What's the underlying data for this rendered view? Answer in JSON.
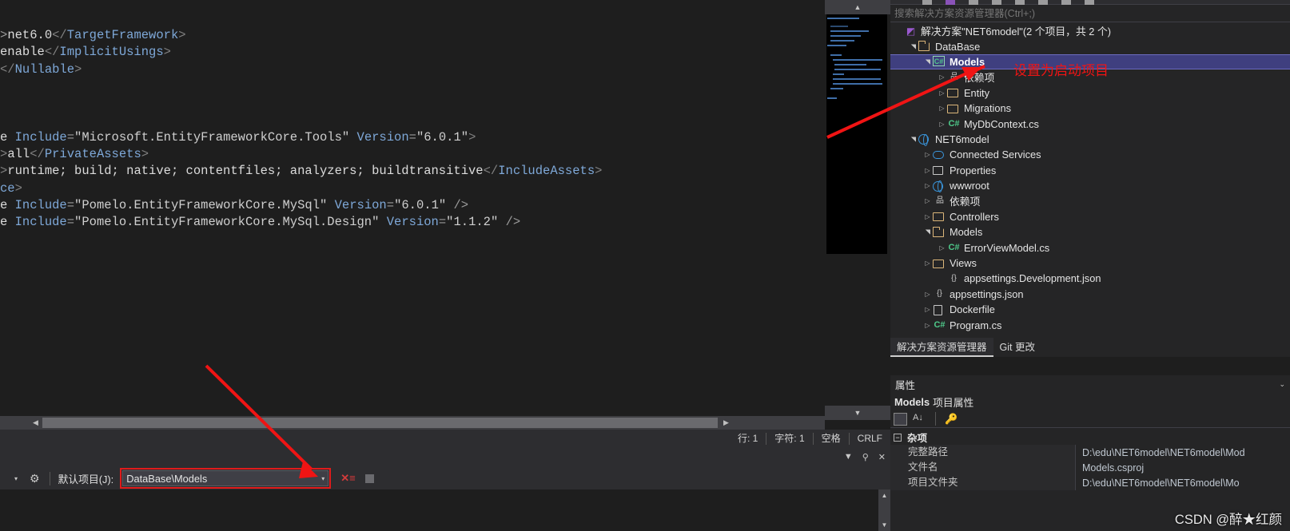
{
  "editor": {
    "lines": [
      {
        "id": "l1",
        "parts": [
          {
            "t": "punct",
            "s": ">"
          },
          {
            "t": "txt",
            "s": "net6.0"
          },
          {
            "t": "tagp",
            "s": "</"
          },
          {
            "t": "tag",
            "s": "TargetFramework"
          },
          {
            "t": "tagp",
            "s": ">"
          }
        ]
      },
      {
        "id": "l2",
        "parts": [
          {
            "t": "txt",
            "s": "enable"
          },
          {
            "t": "tagp",
            "s": "</"
          },
          {
            "t": "tag",
            "s": "ImplicitUsings"
          },
          {
            "t": "tagp",
            "s": ">"
          }
        ]
      },
      {
        "id": "l3",
        "parts": [
          {
            "t": "tagp",
            "s": "</"
          },
          {
            "t": "tag",
            "s": "Nullable"
          },
          {
            "t": "tagp",
            "s": ">"
          }
        ]
      },
      {
        "id": "l4",
        "parts": []
      },
      {
        "id": "l5",
        "parts": []
      },
      {
        "id": "l6",
        "parts": []
      },
      {
        "id": "l7",
        "parts": [
          {
            "t": "txt",
            "s": "e "
          },
          {
            "t": "attr",
            "s": "Include"
          },
          {
            "t": "punct",
            "s": "="
          },
          {
            "t": "str",
            "s": "\"Microsoft.EntityFrameworkCore.Tools\""
          },
          {
            "t": "txt",
            "s": " "
          },
          {
            "t": "attr",
            "s": "Version"
          },
          {
            "t": "punct",
            "s": "="
          },
          {
            "t": "str",
            "s": "\"6.0.1\""
          },
          {
            "t": "tagp",
            "s": ">"
          }
        ]
      },
      {
        "id": "l8",
        "parts": [
          {
            "t": "tagp",
            "s": ">"
          },
          {
            "t": "txt",
            "s": "all"
          },
          {
            "t": "tagp",
            "s": "</"
          },
          {
            "t": "tag",
            "s": "PrivateAssets"
          },
          {
            "t": "tagp",
            "s": ">"
          }
        ]
      },
      {
        "id": "l9",
        "parts": [
          {
            "t": "tagp",
            "s": ">"
          },
          {
            "t": "txt",
            "s": "runtime; build; native; contentfiles; analyzers; buildtransitive"
          },
          {
            "t": "tagp",
            "s": "</"
          },
          {
            "t": "tag",
            "s": "IncludeAssets"
          },
          {
            "t": "tagp",
            "s": ">"
          }
        ]
      },
      {
        "id": "l10",
        "parts": [
          {
            "t": "tag",
            "s": "ce"
          },
          {
            "t": "tagp",
            "s": ">"
          }
        ]
      },
      {
        "id": "l11",
        "parts": [
          {
            "t": "txt",
            "s": "e "
          },
          {
            "t": "attr",
            "s": "Include"
          },
          {
            "t": "punct",
            "s": "="
          },
          {
            "t": "str",
            "s": "\"Pomelo.EntityFrameworkCore.MySql\""
          },
          {
            "t": "txt",
            "s": " "
          },
          {
            "t": "attr",
            "s": "Version"
          },
          {
            "t": "punct",
            "s": "="
          },
          {
            "t": "str",
            "s": "\"6.0.1\""
          },
          {
            "t": "punct",
            "s": " />"
          }
        ]
      },
      {
        "id": "l12",
        "parts": [
          {
            "t": "txt",
            "s": "e "
          },
          {
            "t": "attr",
            "s": "Include"
          },
          {
            "t": "punct",
            "s": "="
          },
          {
            "t": "str",
            "s": "\"Pomelo.EntityFrameworkCore.MySql.Design\""
          },
          {
            "t": "txt",
            "s": " "
          },
          {
            "t": "attr",
            "s": "Version"
          },
          {
            "t": "punct",
            "s": "="
          },
          {
            "t": "str",
            "s": "\"1.1.2\""
          },
          {
            "t": "punct",
            "s": " />"
          }
        ]
      }
    ],
    "scroll_left_arrow": "◀",
    "scroll_right_arrow": "▶"
  },
  "minimap": {
    "up_arrow": "▲",
    "down_arrow": "▼"
  },
  "status_bar": {
    "line": "行: 1",
    "char": "字符: 1",
    "indent": "空格",
    "eol": "CRLF"
  },
  "solution_explorer": {
    "search_placeholder": "搜索解决方案资源管理器(Ctrl+;)",
    "tree": [
      {
        "label": "解决方案\"NET6model\"(2 个项目，共 2 个)",
        "icon": "solution-icon",
        "indent": 0,
        "expander": "none",
        "selected": false
      },
      {
        "label": "DataBase",
        "icon": "folder-open-icon",
        "indent": 1,
        "expander": "open",
        "selected": false
      },
      {
        "label": "Models",
        "icon": "csharp-project-icon",
        "indent": 2,
        "expander": "open",
        "selected": true
      },
      {
        "label": "依赖项",
        "icon": "dependencies-icon",
        "indent": 3,
        "expander": "closed",
        "selected": false
      },
      {
        "label": "Entity",
        "icon": "folder-icon",
        "indent": 3,
        "expander": "closed",
        "selected": false
      },
      {
        "label": "Migrations",
        "icon": "folder-icon",
        "indent": 3,
        "expander": "closed",
        "selected": false
      },
      {
        "label": "MyDbContext.cs",
        "icon": "csharp-file-icon",
        "indent": 3,
        "expander": "closed",
        "selected": false
      },
      {
        "label": "NET6model",
        "icon": "web-project-icon",
        "indent": 1,
        "expander": "open",
        "selected": false
      },
      {
        "label": "Connected Services",
        "icon": "cloud-icon",
        "indent": 2,
        "expander": "closed",
        "selected": false
      },
      {
        "label": "Properties",
        "icon": "properties-icon",
        "indent": 2,
        "expander": "closed",
        "selected": false
      },
      {
        "label": "wwwroot",
        "icon": "globe-icon",
        "indent": 2,
        "expander": "closed",
        "selected": false
      },
      {
        "label": "依赖项",
        "icon": "dependencies-icon",
        "indent": 2,
        "expander": "closed",
        "selected": false
      },
      {
        "label": "Controllers",
        "icon": "folder-icon",
        "indent": 2,
        "expander": "closed",
        "selected": false
      },
      {
        "label": "Models",
        "icon": "folder-open-icon",
        "indent": 2,
        "expander": "open",
        "selected": false
      },
      {
        "label": "ErrorViewModel.cs",
        "icon": "csharp-file-icon",
        "indent": 3,
        "expander": "closed",
        "selected": false
      },
      {
        "label": "Views",
        "icon": "folder-icon",
        "indent": 2,
        "expander": "closed",
        "selected": false
      },
      {
        "label": "appsettings.Development.json",
        "icon": "json-icon",
        "indent": 3,
        "expander": "none",
        "selected": false
      },
      {
        "label": "appsettings.json",
        "icon": "json-icon",
        "indent": 2,
        "expander": "closed",
        "selected": false
      },
      {
        "label": "Dockerfile",
        "icon": "file-icon",
        "indent": 2,
        "expander": "closed",
        "selected": false
      },
      {
        "label": "Program.cs",
        "icon": "csharp-file-icon",
        "indent": 2,
        "expander": "closed",
        "selected": false
      }
    ],
    "tabs": [
      {
        "label": "解决方案资源管理器",
        "active": true
      },
      {
        "label": "Git 更改",
        "active": false
      }
    ]
  },
  "properties": {
    "title": "属性",
    "collapse_chevron": "⌄",
    "subject_bold": "Models",
    "subject_rest": "项目属性",
    "category": "杂项",
    "category_toggle": "−",
    "rows": [
      {
        "key": "完整路径",
        "value": "D:\\edu\\NET6model\\NET6model\\Mod"
      },
      {
        "key": "文件名",
        "value": "Models.csproj"
      },
      {
        "key": "项目文件夹",
        "value": "D:\\edu\\NET6model\\NET6model\\Mo"
      }
    ]
  },
  "console": {
    "pin_icon": "📌",
    "close_icon": "✕",
    "dropdown_icon": "▼",
    "toolbar_chevron": "▾",
    "gear_icon": "⚙",
    "project_label": "默认项目(J):",
    "project_value": "DataBase\\Models",
    "combo_arrow": "▾",
    "clear_icon": "✕≡",
    "scroll_up": "▲",
    "scroll_down": "▼"
  },
  "annotations": {
    "set_startup_project": "设置为启动项目",
    "accent_red": "#f01414"
  },
  "watermark": "CSDN @醉★红颜"
}
